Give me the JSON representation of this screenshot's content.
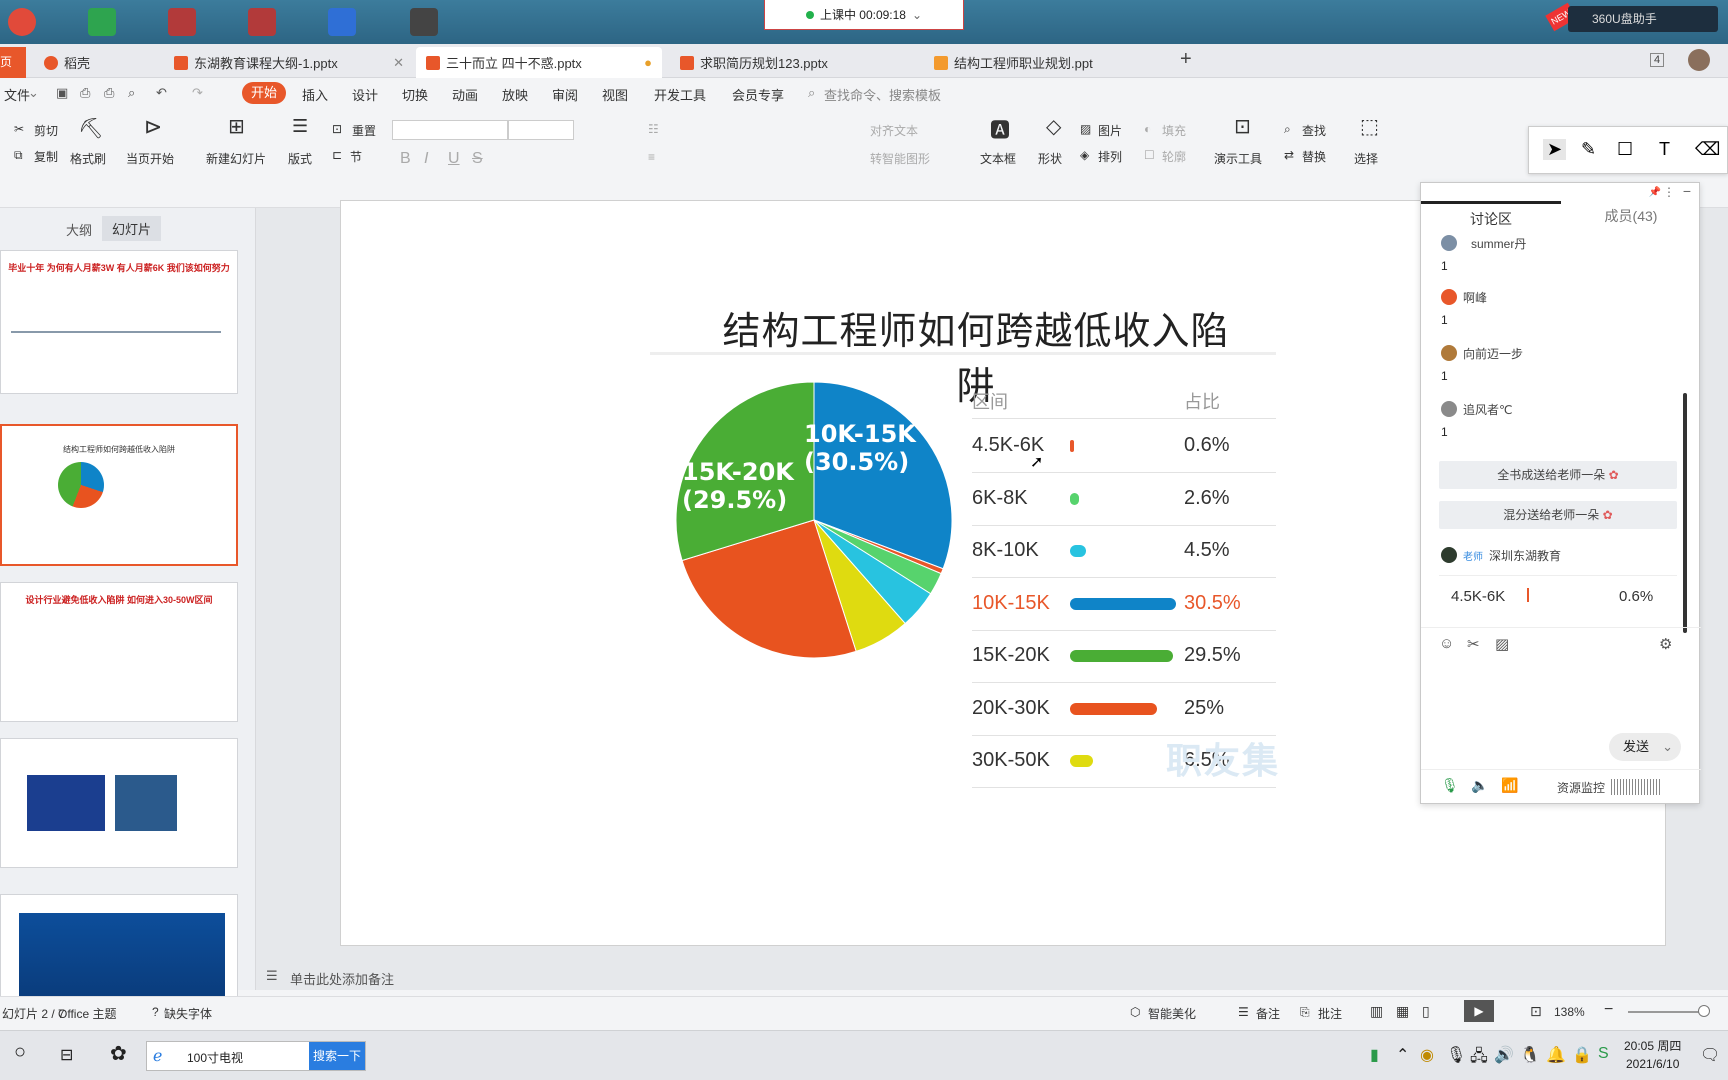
{
  "desktop": {
    "class_status": "上课中 00:09:18",
    "helper": "360U盘助手",
    "helper_badge": "NEW"
  },
  "tabs": [
    {
      "label": "稻壳",
      "color": "#e8572a"
    },
    {
      "label": "东湖教育课程大纲-1.pptx",
      "color": "#e8572a"
    },
    {
      "label": "三十而立 四十不惑.pptx",
      "color": "#e8572a"
    },
    {
      "label": "求职简历规划123.pptx",
      "color": "#e8572a"
    },
    {
      "label": "结构工程师职业规划.ppt",
      "color": "#f39a2e"
    }
  ],
  "tab_add": "+",
  "tab_count": "4",
  "menu": {
    "file": "文件",
    "start": "开始",
    "items": [
      "插入",
      "设计",
      "切换",
      "动画",
      "放映",
      "审阅",
      "视图",
      "开发工具",
      "会员专享"
    ],
    "search_placeholder": "查找命令、搜索模板"
  },
  "ribbon": {
    "cut": "剪切",
    "copy": "复制",
    "format_painter": "格式刷",
    "from_current": "当页开始",
    "new_slide": "新建幻灯片",
    "layout": "版式",
    "reset": "重置",
    "section": "节",
    "align_text": "对齐文本",
    "smart_shape": "转智能图形",
    "textbox": "文本框",
    "shape": "形状",
    "picture": "图片",
    "arrange": "排列",
    "fill": "填充",
    "outline": "轮廓",
    "presentation_tools": "演示工具",
    "find": "查找",
    "replace": "替换",
    "select": "选择"
  },
  "left_panel": {
    "tab_outline": "大纲",
    "tab_slides": "幻灯片",
    "thumb1_title": "毕业十年 为何有人月薪3W  有人月薪6K 我们该如何努力",
    "thumb2_title": "结构工程师如何跨越低收入陷阱",
    "thumb3_title": "设计行业避免低收入陷阱  如何进入30-50W区间",
    "add": "+"
  },
  "slide": {
    "title": "结构工程师如何跨越低收入陷阱",
    "col_range": "区间",
    "col_share": "占比",
    "pie_label_1": "10K-15K",
    "pie_pct_1": "(30.5%)",
    "pie_label_2": "15K-20K",
    "pie_pct_2": "(29.5%)",
    "watermark": "职友集"
  },
  "chart_data": {
    "type": "pie",
    "title": "结构工程师如何跨越低收入陷阱",
    "categories": [
      "4.5K-6K",
      "6K-8K",
      "8K-10K",
      "10K-15K",
      "15K-20K",
      "20K-30K",
      "30K-50K"
    ],
    "values": [
      0.6,
      2.6,
      4.5,
      30.5,
      29.5,
      25,
      6.5
    ],
    "value_labels": [
      "0.6%",
      "2.6%",
      "4.5%",
      "30.5%",
      "29.5%",
      "25%",
      "6.5%"
    ],
    "colors": [
      "#e8572a",
      "#57d36d",
      "#28c3e0",
      "#0f84c8",
      "#4aad35",
      "#e8531f",
      "#dfdb10"
    ],
    "highlight": "10K-15K",
    "highlight_color": "#e8572a"
  },
  "notes": "单击此处添加备注",
  "status": {
    "page": "幻灯片 2 / 7",
    "theme": "Office 主题",
    "missing_font": "缺失字体",
    "smart_beautify": "智能美化",
    "notes": "备注",
    "comments": "批注",
    "zoom": "138%"
  },
  "discussion": {
    "tab_discuss": "讨论区",
    "tab_members": "成员(43)",
    "messages": [
      {
        "name": "summer丹",
        "text": "1",
        "color": "#7c8fa5"
      },
      {
        "name": "啊峰",
        "text": "1",
        "color": "#e8572a"
      },
      {
        "name": "向前迈一步",
        "text": "1",
        "color": "#b07a3a"
      },
      {
        "name": "追风者℃",
        "text": "1",
        "color": "#8a8a8a"
      }
    ],
    "gift1": "全书成送给老师一朵",
    "gift2": "混分送给老师一朵",
    "teacher_tag": "老师",
    "teacher_name": "深圳东湖教育",
    "teacher_msg_range": "4.5K-6K",
    "teacher_msg_pct": "0.6%",
    "send": "发送",
    "resource_monitor": "资源监控"
  },
  "taskbar": {
    "browser_text": "100寸电视",
    "search_btn": "搜索一下",
    "time": "20:05 周四",
    "date": "2021/6/10"
  }
}
